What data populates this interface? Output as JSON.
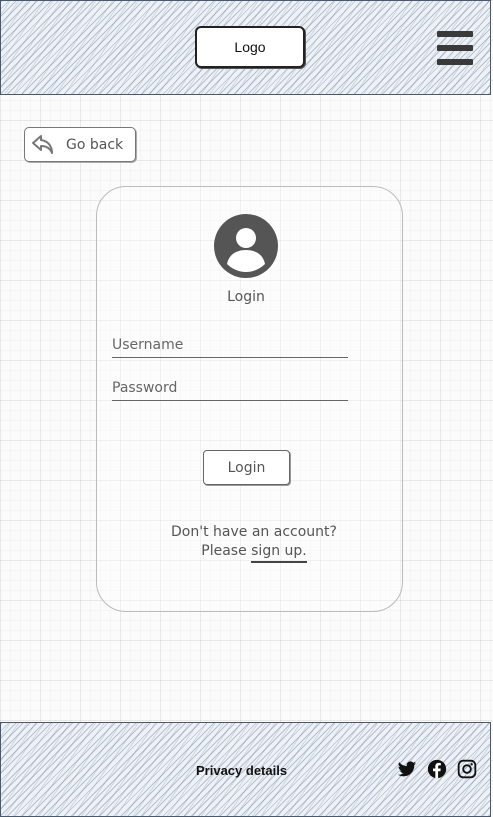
{
  "header": {
    "logo_label": "Logo"
  },
  "nav": {
    "back_label": "Go back"
  },
  "login_card": {
    "title": "Login",
    "username_placeholder": "Username",
    "password_placeholder": "Password",
    "submit_label": "Login",
    "no_account_text": "Don't have an account?",
    "please_text": "Please ",
    "signup_link": "sign up."
  },
  "footer": {
    "privacy_label": "Privacy details",
    "social_icons": [
      "twitter-icon",
      "facebook-icon",
      "instagram-icon"
    ]
  }
}
